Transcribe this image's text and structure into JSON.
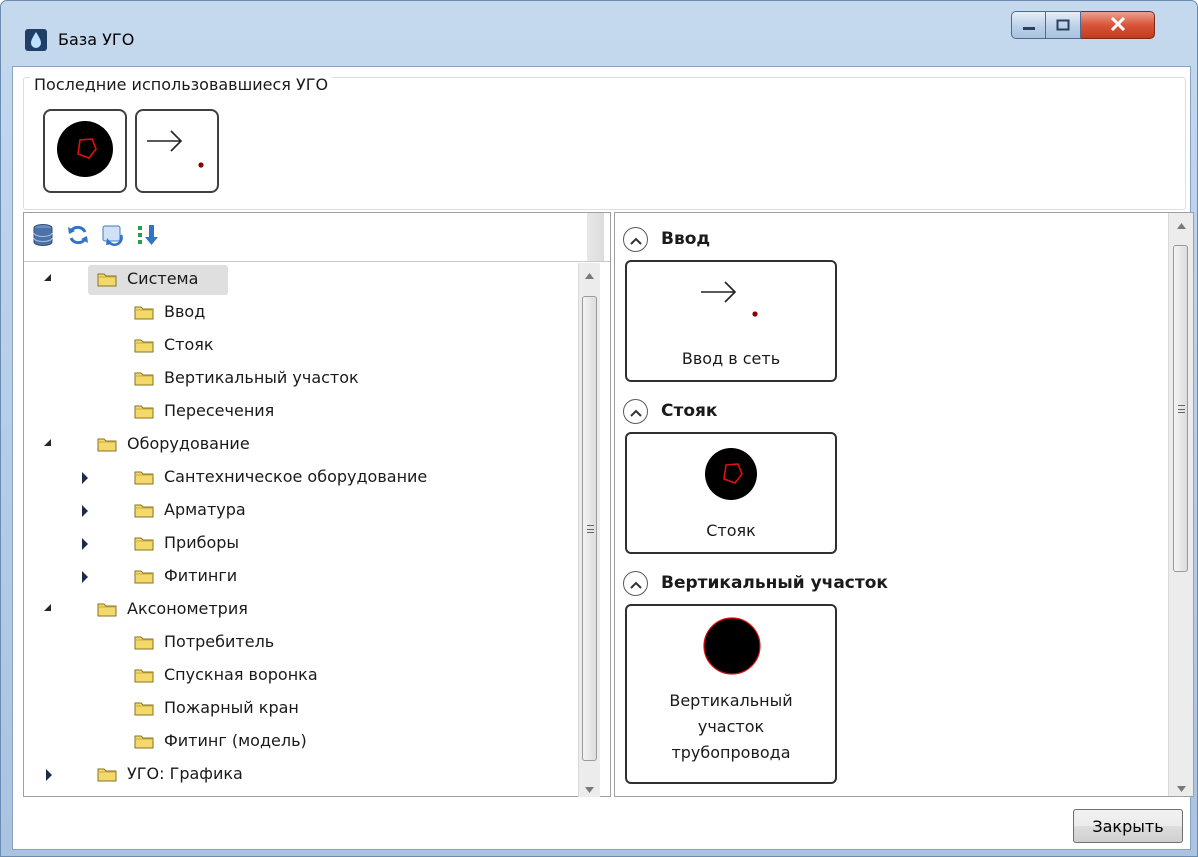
{
  "window": {
    "title": "База УГО",
    "minimize_icon": "minimize-icon",
    "maximize_icon": "maximize-icon",
    "close_icon": "close-icon"
  },
  "recent": {
    "legend": "Последние использовавшиеся УГО",
    "symbols": [
      "riser-symbol",
      "inlet-arrow-symbol"
    ]
  },
  "toolbar": {
    "icons": [
      "database-icon",
      "refresh-icon",
      "sync-icon",
      "sort-icon"
    ]
  },
  "tree": {
    "items": [
      {
        "label": "Система",
        "level": 0,
        "state": "expanded",
        "selected": true
      },
      {
        "label": "Ввод",
        "level": 1,
        "state": "leaf"
      },
      {
        "label": "Стояк",
        "level": 1,
        "state": "leaf"
      },
      {
        "label": "Вертикальный участок",
        "level": 1,
        "state": "leaf"
      },
      {
        "label": "Пересечения",
        "level": 1,
        "state": "leaf"
      },
      {
        "label": "Оборудование",
        "level": 0,
        "state": "expanded"
      },
      {
        "label": "Сантехническое оборудование",
        "level": 1,
        "state": "collapsed"
      },
      {
        "label": "Арматура",
        "level": 1,
        "state": "collapsed"
      },
      {
        "label": "Приборы",
        "level": 1,
        "state": "collapsed"
      },
      {
        "label": "Фитинги",
        "level": 1,
        "state": "collapsed"
      },
      {
        "label": "Аксонометрия",
        "level": 0,
        "state": "expanded"
      },
      {
        "label": "Потребитель",
        "level": 1,
        "state": "leaf"
      },
      {
        "label": "Спускная воронка",
        "level": 1,
        "state": "leaf"
      },
      {
        "label": "Пожарный кран",
        "level": 1,
        "state": "leaf"
      },
      {
        "label": "Фитинг (модель)",
        "level": 1,
        "state": "leaf"
      },
      {
        "label": "УГО: Графика",
        "level": 0,
        "state": "collapsed"
      }
    ]
  },
  "groups": [
    {
      "title": "Ввод",
      "tile_lines": [
        "Ввод в сеть"
      ],
      "symbol": "inlet-arrow-symbol"
    },
    {
      "title": "Стояк",
      "tile_lines": [
        "Стояк"
      ],
      "symbol": "riser-symbol"
    },
    {
      "title": "Вертикальный участок",
      "tile_lines": [
        "Вертикальный",
        "участок",
        "трубопровода"
      ],
      "symbol": "vertical-segment-symbol"
    }
  ],
  "footer": {
    "close_label": "Закрыть"
  },
  "colors": {
    "titlebar": "#b8cfe8",
    "close_button": "#c9452a",
    "symbol_red": "#e01010",
    "symbol_black": "#000000",
    "selection": "#dfdfdf"
  }
}
